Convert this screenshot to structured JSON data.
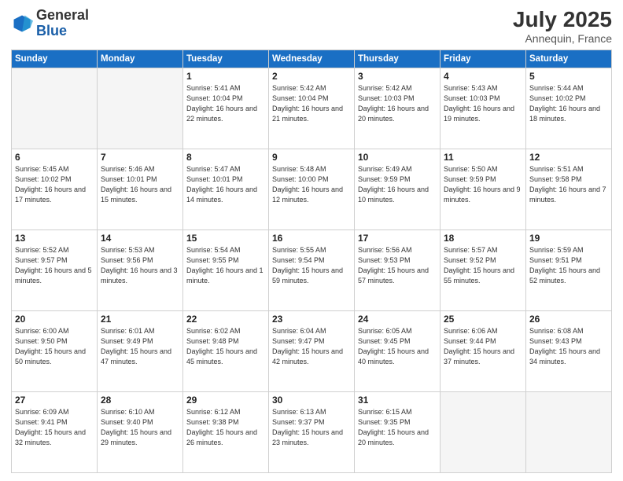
{
  "header": {
    "logo_general": "General",
    "logo_blue": "Blue",
    "title": "July 2025",
    "subtitle": "Annequin, France"
  },
  "weekdays": [
    "Sunday",
    "Monday",
    "Tuesday",
    "Wednesday",
    "Thursday",
    "Friday",
    "Saturday"
  ],
  "weeks": [
    [
      {
        "day": "",
        "info": ""
      },
      {
        "day": "",
        "info": ""
      },
      {
        "day": "1",
        "info": "Sunrise: 5:41 AM\nSunset: 10:04 PM\nDaylight: 16 hours\nand 22 minutes."
      },
      {
        "day": "2",
        "info": "Sunrise: 5:42 AM\nSunset: 10:04 PM\nDaylight: 16 hours\nand 21 minutes."
      },
      {
        "day": "3",
        "info": "Sunrise: 5:42 AM\nSunset: 10:03 PM\nDaylight: 16 hours\nand 20 minutes."
      },
      {
        "day": "4",
        "info": "Sunrise: 5:43 AM\nSunset: 10:03 PM\nDaylight: 16 hours\nand 19 minutes."
      },
      {
        "day": "5",
        "info": "Sunrise: 5:44 AM\nSunset: 10:02 PM\nDaylight: 16 hours\nand 18 minutes."
      }
    ],
    [
      {
        "day": "6",
        "info": "Sunrise: 5:45 AM\nSunset: 10:02 PM\nDaylight: 16 hours\nand 17 minutes."
      },
      {
        "day": "7",
        "info": "Sunrise: 5:46 AM\nSunset: 10:01 PM\nDaylight: 16 hours\nand 15 minutes."
      },
      {
        "day": "8",
        "info": "Sunrise: 5:47 AM\nSunset: 10:01 PM\nDaylight: 16 hours\nand 14 minutes."
      },
      {
        "day": "9",
        "info": "Sunrise: 5:48 AM\nSunset: 10:00 PM\nDaylight: 16 hours\nand 12 minutes."
      },
      {
        "day": "10",
        "info": "Sunrise: 5:49 AM\nSunset: 9:59 PM\nDaylight: 16 hours\nand 10 minutes."
      },
      {
        "day": "11",
        "info": "Sunrise: 5:50 AM\nSunset: 9:59 PM\nDaylight: 16 hours\nand 9 minutes."
      },
      {
        "day": "12",
        "info": "Sunrise: 5:51 AM\nSunset: 9:58 PM\nDaylight: 16 hours\nand 7 minutes."
      }
    ],
    [
      {
        "day": "13",
        "info": "Sunrise: 5:52 AM\nSunset: 9:57 PM\nDaylight: 16 hours\nand 5 minutes."
      },
      {
        "day": "14",
        "info": "Sunrise: 5:53 AM\nSunset: 9:56 PM\nDaylight: 16 hours\nand 3 minutes."
      },
      {
        "day": "15",
        "info": "Sunrise: 5:54 AM\nSunset: 9:55 PM\nDaylight: 16 hours\nand 1 minute."
      },
      {
        "day": "16",
        "info": "Sunrise: 5:55 AM\nSunset: 9:54 PM\nDaylight: 15 hours\nand 59 minutes."
      },
      {
        "day": "17",
        "info": "Sunrise: 5:56 AM\nSunset: 9:53 PM\nDaylight: 15 hours\nand 57 minutes."
      },
      {
        "day": "18",
        "info": "Sunrise: 5:57 AM\nSunset: 9:52 PM\nDaylight: 15 hours\nand 55 minutes."
      },
      {
        "day": "19",
        "info": "Sunrise: 5:59 AM\nSunset: 9:51 PM\nDaylight: 15 hours\nand 52 minutes."
      }
    ],
    [
      {
        "day": "20",
        "info": "Sunrise: 6:00 AM\nSunset: 9:50 PM\nDaylight: 15 hours\nand 50 minutes."
      },
      {
        "day": "21",
        "info": "Sunrise: 6:01 AM\nSunset: 9:49 PM\nDaylight: 15 hours\nand 47 minutes."
      },
      {
        "day": "22",
        "info": "Sunrise: 6:02 AM\nSunset: 9:48 PM\nDaylight: 15 hours\nand 45 minutes."
      },
      {
        "day": "23",
        "info": "Sunrise: 6:04 AM\nSunset: 9:47 PM\nDaylight: 15 hours\nand 42 minutes."
      },
      {
        "day": "24",
        "info": "Sunrise: 6:05 AM\nSunset: 9:45 PM\nDaylight: 15 hours\nand 40 minutes."
      },
      {
        "day": "25",
        "info": "Sunrise: 6:06 AM\nSunset: 9:44 PM\nDaylight: 15 hours\nand 37 minutes."
      },
      {
        "day": "26",
        "info": "Sunrise: 6:08 AM\nSunset: 9:43 PM\nDaylight: 15 hours\nand 34 minutes."
      }
    ],
    [
      {
        "day": "27",
        "info": "Sunrise: 6:09 AM\nSunset: 9:41 PM\nDaylight: 15 hours\nand 32 minutes."
      },
      {
        "day": "28",
        "info": "Sunrise: 6:10 AM\nSunset: 9:40 PM\nDaylight: 15 hours\nand 29 minutes."
      },
      {
        "day": "29",
        "info": "Sunrise: 6:12 AM\nSunset: 9:38 PM\nDaylight: 15 hours\nand 26 minutes."
      },
      {
        "day": "30",
        "info": "Sunrise: 6:13 AM\nSunset: 9:37 PM\nDaylight: 15 hours\nand 23 minutes."
      },
      {
        "day": "31",
        "info": "Sunrise: 6:15 AM\nSunset: 9:35 PM\nDaylight: 15 hours\nand 20 minutes."
      },
      {
        "day": "",
        "info": ""
      },
      {
        "day": "",
        "info": ""
      }
    ]
  ]
}
